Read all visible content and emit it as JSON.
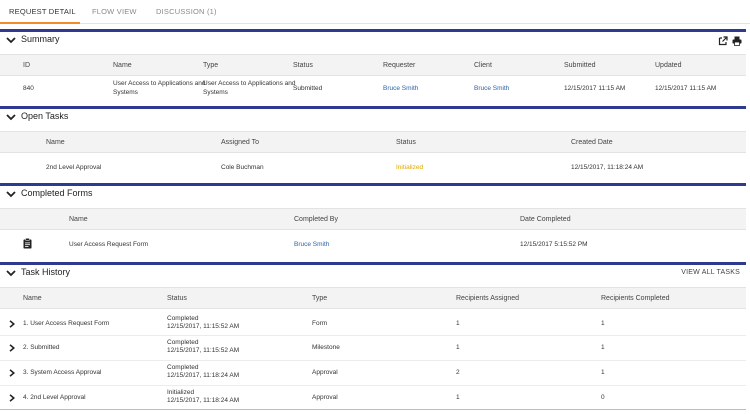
{
  "tabs": [
    {
      "label": "REQUEST DETAIL",
      "active": true
    },
    {
      "label": "FLOW VIEW",
      "active": false
    },
    {
      "label": "DISCUSSION (1)",
      "active": false
    }
  ],
  "colors": {
    "accent": "#2f3a8f",
    "link": "#2d62a8",
    "warning": "#e0a800",
    "tab_active_underline": "#f28c28"
  },
  "summary": {
    "title": "Summary",
    "columns": [
      "ID",
      "Name",
      "Type",
      "Status",
      "Requester",
      "Client",
      "Submitted",
      "Updated"
    ],
    "row": {
      "id": "840",
      "name_line1": "User Access to Applications and",
      "name_line2": "Systems",
      "type_line1": "User Access to Applications and",
      "type_line2": "Systems",
      "status": "Submitted",
      "requester": "Bruce Smith",
      "client": "Bruce Smith",
      "submitted": "12/15/2017 11:15 AM",
      "updated": "12/15/2017 11:15 AM"
    },
    "icons": [
      "external-link-icon",
      "print-icon"
    ]
  },
  "open_tasks": {
    "title": "Open Tasks",
    "columns": [
      "Name",
      "Assigned To",
      "Status",
      "Created Date"
    ],
    "row": {
      "name": "2nd Level Approval",
      "assigned": "Cole Buchman",
      "status": "Initialized",
      "created": "12/15/2017, 11:18:24 AM"
    }
  },
  "completed_forms": {
    "title": "Completed Forms",
    "columns": [
      "Name",
      "Completed By",
      "Date Completed"
    ],
    "row": {
      "icon": "clipboard-icon",
      "name": "User Access Request Form",
      "completed_by": "Bruce Smith",
      "date": "12/15/2017 5:15:52 PM"
    }
  },
  "task_history": {
    "title": "Task History",
    "view_all": "VIEW ALL TASKS",
    "columns": [
      "Name",
      "Status",
      "Type",
      "Recipients Assigned",
      "Recipients Completed"
    ],
    "rows": [
      {
        "name": "1. User Access Request Form",
        "status": "Completed",
        "date": "12/15/2017, 11:15:52 AM",
        "type": "Form",
        "assigned": "1",
        "completed": "1"
      },
      {
        "name": "2. Submitted",
        "status": "Completed",
        "date": "12/15/2017, 11:15:52 AM",
        "type": "Milestone",
        "assigned": "1",
        "completed": "1"
      },
      {
        "name": "3. System Access Approval",
        "status": "Completed",
        "date": "12/15/2017, 11:18:24 AM",
        "type": "Approval",
        "assigned": "2",
        "completed": "1"
      },
      {
        "name": "4. 2nd Level Approval",
        "status": "Initialized",
        "date": "12/15/2017, 11:18:24 AM",
        "type": "Approval",
        "assigned": "1",
        "completed": "0"
      }
    ]
  }
}
